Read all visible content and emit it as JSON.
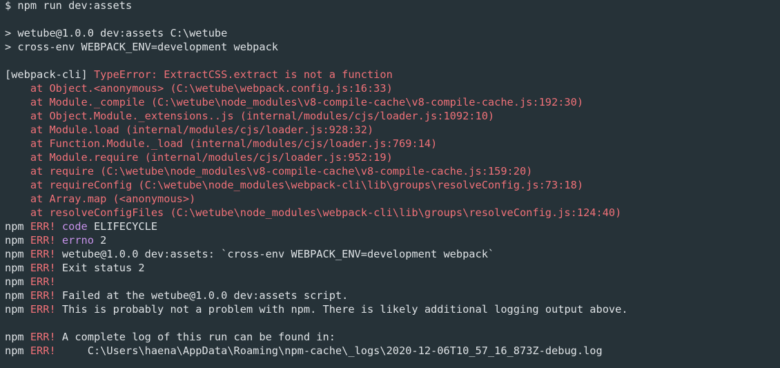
{
  "colors": {
    "background": "#263238",
    "default": "#dfe3e6",
    "red": "#f07178",
    "purple": "#c792ea"
  },
  "lines": [
    [
      {
        "t": "$ npm run dev:assets",
        "c": "default"
      }
    ],
    [],
    [
      {
        "t": "> wetube@1.0.0 dev:assets C:\\wetube",
        "c": "default"
      }
    ],
    [
      {
        "t": "> cross-env WEBPACK_ENV=development webpack",
        "c": "default"
      }
    ],
    [],
    [
      {
        "t": "[webpack-cli] ",
        "c": "default"
      },
      {
        "t": "TypeError: ExtractCSS.extract is not a function",
        "c": "red"
      }
    ],
    [
      {
        "t": "    at Object.<anonymous> (C:\\wetube\\webpack.config.js:16:33)",
        "c": "red"
      }
    ],
    [
      {
        "t": "    at Module._compile (C:\\wetube\\node_modules\\v8-compile-cache\\v8-compile-cache.js:192:30)",
        "c": "red"
      }
    ],
    [
      {
        "t": "    at Object.Module._extensions..js (internal/modules/cjs/loader.js:1092:10)",
        "c": "red"
      }
    ],
    [
      {
        "t": "    at Module.load (internal/modules/cjs/loader.js:928:32)",
        "c": "red"
      }
    ],
    [
      {
        "t": "    at Function.Module._load (internal/modules/cjs/loader.js:769:14)",
        "c": "red"
      }
    ],
    [
      {
        "t": "    at Module.require (internal/modules/cjs/loader.js:952:19)",
        "c": "red"
      }
    ],
    [
      {
        "t": "    at require (C:\\wetube\\node_modules\\v8-compile-cache\\v8-compile-cache.js:159:20)",
        "c": "red"
      }
    ],
    [
      {
        "t": "    at requireConfig (C:\\wetube\\node_modules\\webpack-cli\\lib\\groups\\resolveConfig.js:73:18)",
        "c": "red"
      }
    ],
    [
      {
        "t": "    at Array.map (<anonymous>)",
        "c": "red"
      }
    ],
    [
      {
        "t": "    at resolveConfigFiles (C:\\wetube\\node_modules\\webpack-cli\\lib\\groups\\resolveConfig.js:124:40)",
        "c": "red"
      }
    ],
    [
      {
        "t": "npm ",
        "c": "default"
      },
      {
        "t": "ERR!",
        "c": "red"
      },
      {
        "t": " ",
        "c": "default"
      },
      {
        "t": "code",
        "c": "purple"
      },
      {
        "t": " ELIFECYCLE",
        "c": "default"
      }
    ],
    [
      {
        "t": "npm ",
        "c": "default"
      },
      {
        "t": "ERR!",
        "c": "red"
      },
      {
        "t": " ",
        "c": "default"
      },
      {
        "t": "errno",
        "c": "purple"
      },
      {
        "t": " 2",
        "c": "default"
      }
    ],
    [
      {
        "t": "npm ",
        "c": "default"
      },
      {
        "t": "ERR!",
        "c": "red"
      },
      {
        "t": " wetube@1.0.0 dev:assets: `cross-env WEBPACK_ENV=development webpack`",
        "c": "default"
      }
    ],
    [
      {
        "t": "npm ",
        "c": "default"
      },
      {
        "t": "ERR!",
        "c": "red"
      },
      {
        "t": " Exit status 2",
        "c": "default"
      }
    ],
    [
      {
        "t": "npm ",
        "c": "default"
      },
      {
        "t": "ERR!",
        "c": "red"
      }
    ],
    [
      {
        "t": "npm ",
        "c": "default"
      },
      {
        "t": "ERR!",
        "c": "red"
      },
      {
        "t": " Failed at the wetube@1.0.0 dev:assets script.",
        "c": "default"
      }
    ],
    [
      {
        "t": "npm ",
        "c": "default"
      },
      {
        "t": "ERR!",
        "c": "red"
      },
      {
        "t": " This is probably not a problem with npm. There is likely additional logging output above.",
        "c": "default"
      }
    ],
    [],
    [
      {
        "t": "npm ",
        "c": "default"
      },
      {
        "t": "ERR!",
        "c": "red"
      },
      {
        "t": " A complete log of this run can be found in:",
        "c": "default"
      }
    ],
    [
      {
        "t": "npm ",
        "c": "default"
      },
      {
        "t": "ERR!",
        "c": "red"
      },
      {
        "t": "     C:\\Users\\haena\\AppData\\Roaming\\npm-cache\\_logs\\2020-12-06T10_57_16_873Z-debug.log",
        "c": "default"
      }
    ]
  ]
}
